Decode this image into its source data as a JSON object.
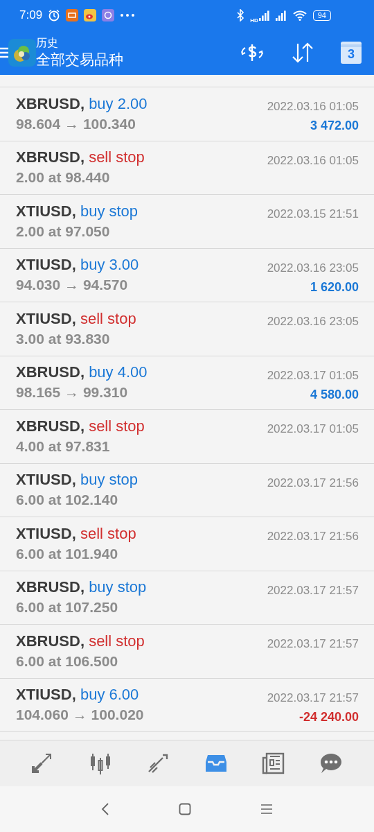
{
  "status_bar": {
    "time": "7:09",
    "network_label": "HD",
    "battery": "94"
  },
  "header": {
    "title": "历史",
    "subtitle": "全部交易品种",
    "calendar_day": "3"
  },
  "trades": [
    {
      "symbol": "XBRUSD,",
      "action": "buy 2.00",
      "kind": "buy",
      "prices": "98.604 → 100.340",
      "time": "2022.03.16 01:05",
      "profit": "3 472.00",
      "loss": false
    },
    {
      "symbol": "XBRUSD,",
      "action": "sell stop",
      "kind": "sell",
      "prices": "2.00 at 98.440",
      "time": "2022.03.16 01:05"
    },
    {
      "symbol": "XTIUSD,",
      "action": "buy stop",
      "kind": "buy",
      "prices": "2.00 at 97.050",
      "time": "2022.03.15 21:51"
    },
    {
      "symbol": "XTIUSD,",
      "action": "buy 3.00",
      "kind": "buy",
      "prices": "94.030 → 94.570",
      "time": "2022.03.16 23:05",
      "profit": "1 620.00",
      "loss": false
    },
    {
      "symbol": "XTIUSD,",
      "action": "sell stop",
      "kind": "sell",
      "prices": "3.00 at 93.830",
      "time": "2022.03.16 23:05"
    },
    {
      "symbol": "XBRUSD,",
      "action": "buy 4.00",
      "kind": "buy",
      "prices": "98.165 → 99.310",
      "time": "2022.03.17 01:05",
      "profit": "4 580.00",
      "loss": false
    },
    {
      "symbol": "XBRUSD,",
      "action": "sell stop",
      "kind": "sell",
      "prices": "4.00 at 97.831",
      "time": "2022.03.17 01:05"
    },
    {
      "symbol": "XTIUSD,",
      "action": "buy stop",
      "kind": "buy",
      "prices": "6.00 at 102.140",
      "time": "2022.03.17 21:56"
    },
    {
      "symbol": "XTIUSD,",
      "action": "sell stop",
      "kind": "sell",
      "prices": "6.00 at 101.940",
      "time": "2022.03.17 21:56"
    },
    {
      "symbol": "XBRUSD,",
      "action": "buy stop",
      "kind": "buy",
      "prices": "6.00 at 107.250",
      "time": "2022.03.17 21:57"
    },
    {
      "symbol": "XBRUSD,",
      "action": "sell stop",
      "kind": "sell",
      "prices": "6.00 at 106.500",
      "time": "2022.03.17 21:57"
    },
    {
      "symbol": "XTIUSD,",
      "action": "buy 6.00",
      "kind": "buy",
      "prices": "104.060 → 100.020",
      "time": "2022.03.17 21:57",
      "profit": "-24 240.00",
      "loss": true
    }
  ],
  "bottom_nav": [
    {
      "kind": "quotes",
      "selected": false
    },
    {
      "kind": "chart",
      "selected": false
    },
    {
      "kind": "trade",
      "selected": false
    },
    {
      "kind": "history",
      "selected": true
    },
    {
      "kind": "news",
      "selected": false
    },
    {
      "kind": "chat",
      "selected": false
    }
  ]
}
